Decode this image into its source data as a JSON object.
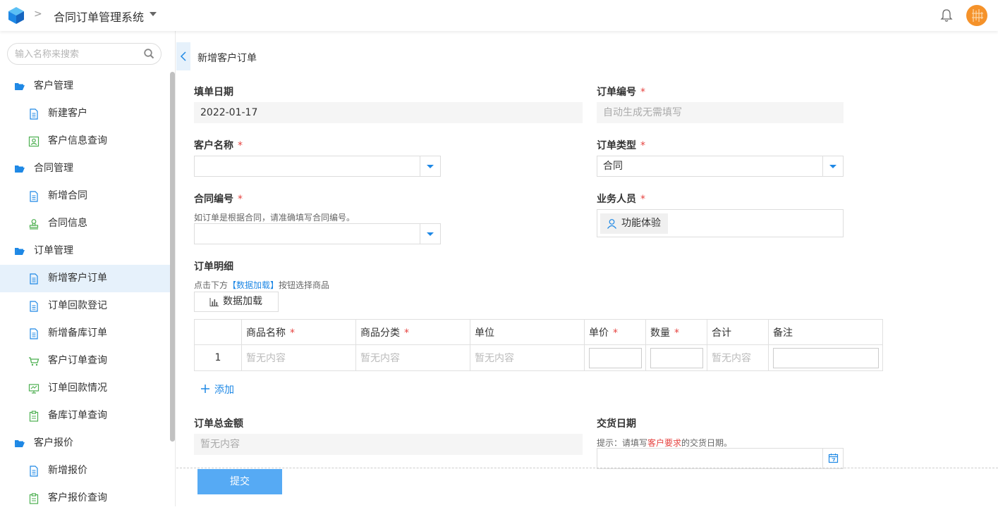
{
  "header": {
    "app_title": "合同订单管理系统"
  },
  "sidebar": {
    "search_placeholder": "输入名称来搜索",
    "items": [
      {
        "label": "客户管理",
        "type": "group",
        "icon": "folder-open-icon"
      },
      {
        "label": "新建客户",
        "type": "sub",
        "icon": "document-icon"
      },
      {
        "label": "客户信息查询",
        "type": "sub",
        "icon": "contact-card-icon"
      },
      {
        "label": "合同管理",
        "type": "group",
        "icon": "folder-open-icon"
      },
      {
        "label": "新增合同",
        "type": "sub",
        "icon": "document-icon"
      },
      {
        "label": "合同信息",
        "type": "sub",
        "icon": "stamp-icon"
      },
      {
        "label": "订单管理",
        "type": "group",
        "icon": "folder-open-icon"
      },
      {
        "label": "新增客户订单",
        "type": "sub",
        "icon": "document-icon",
        "active": true
      },
      {
        "label": "订单回款登记",
        "type": "sub",
        "icon": "document-icon"
      },
      {
        "label": "新增备库订单",
        "type": "sub",
        "icon": "document-icon"
      },
      {
        "label": "客户订单查询",
        "type": "sub",
        "icon": "cart-icon"
      },
      {
        "label": "订单回款情况",
        "type": "sub",
        "icon": "monitor-icon"
      },
      {
        "label": "备库订单查询",
        "type": "sub",
        "icon": "clipboard-icon"
      },
      {
        "label": "客户报价",
        "type": "group",
        "icon": "folder-open-icon"
      },
      {
        "label": "新增报价",
        "type": "sub",
        "icon": "document-icon"
      },
      {
        "label": "客户报价查询",
        "type": "sub",
        "icon": "clipboard-icon"
      }
    ]
  },
  "form": {
    "title": "新增客户订单",
    "fill_date": {
      "label": "填单日期",
      "value": "2022-01-17"
    },
    "order_no": {
      "label": "订单编号",
      "placeholder": "自动生成无需填写"
    },
    "customer_name": {
      "label": "客户名称",
      "value": ""
    },
    "order_type": {
      "label": "订单类型",
      "value": "合同"
    },
    "contract_no": {
      "label": "合同编号",
      "hint": "如订单是根据合同，请准确填写合同编号。",
      "value": ""
    },
    "salesperson": {
      "label": "业务人员",
      "value": "功能体验"
    },
    "details": {
      "label": "订单明细",
      "hint_prefix": "点击下方",
      "hint_link": "【数据加载】",
      "hint_suffix": "按钮选择商品",
      "load_button": "数据加载",
      "columns": [
        "",
        "商品名称",
        "商品分类",
        "单位",
        "单价",
        "数量",
        "合计",
        "备注"
      ],
      "required_columns": [
        false,
        true,
        true,
        false,
        true,
        true,
        false,
        false
      ],
      "rows": [
        {
          "index": "1",
          "name": "暂无内容",
          "category": "暂无内容",
          "unit": "暂无内容",
          "price": "",
          "qty": "",
          "total": "暂无内容",
          "note": ""
        }
      ],
      "add_label": "添加"
    },
    "total_amount": {
      "label": "订单总金额",
      "placeholder": "暂无内容"
    },
    "delivery_date": {
      "label": "交货日期",
      "hint_prefix": "提示：请填写",
      "hint_red": "客户要求",
      "hint_suffix": "的交货日期。",
      "value": ""
    },
    "submit_label": "提交",
    "required_mark": "*"
  },
  "colors": {
    "accent": "#1e88e5",
    "required": "#e64340",
    "submit": "#56aaf4",
    "active_bg": "#e6f1fb",
    "avatar": "#f5922a"
  }
}
